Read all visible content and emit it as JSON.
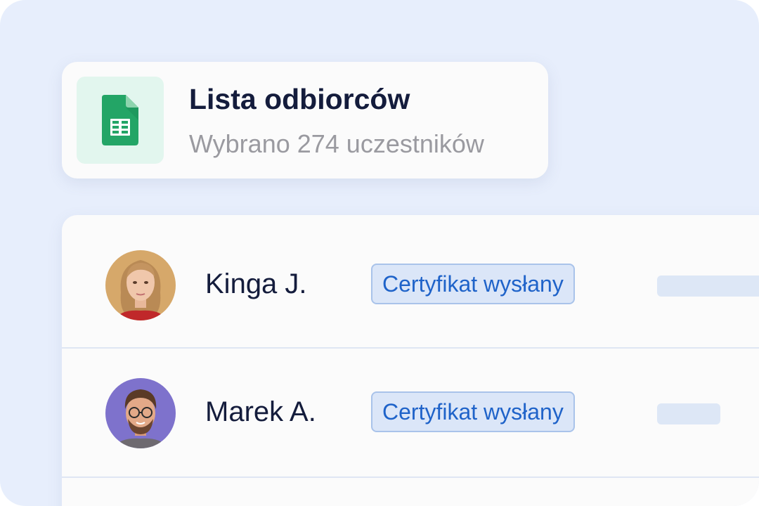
{
  "list_card": {
    "icon": "google-sheets-icon",
    "title": "Lista odbiorców",
    "subtitle": "Wybrano 274 uczestników"
  },
  "recipients": [
    {
      "name": "Kinga J.",
      "avatar": "woman-portrait",
      "status": "Certyfikat wysłany"
    },
    {
      "name": "Marek A.",
      "avatar": "man-with-glasses-portrait",
      "status": "Certyfikat wysłany"
    }
  ],
  "colors": {
    "background": "#e7eefc",
    "card": "#fbfbfb",
    "title": "#141c3c",
    "subtitle": "#9a9aa0",
    "badge_bg": "#dbe6f8",
    "badge_border": "#a9c3ea",
    "badge_text": "#1f63c9",
    "sheets_green": "#23a566",
    "sheets_tile": "#e2f6ee"
  }
}
